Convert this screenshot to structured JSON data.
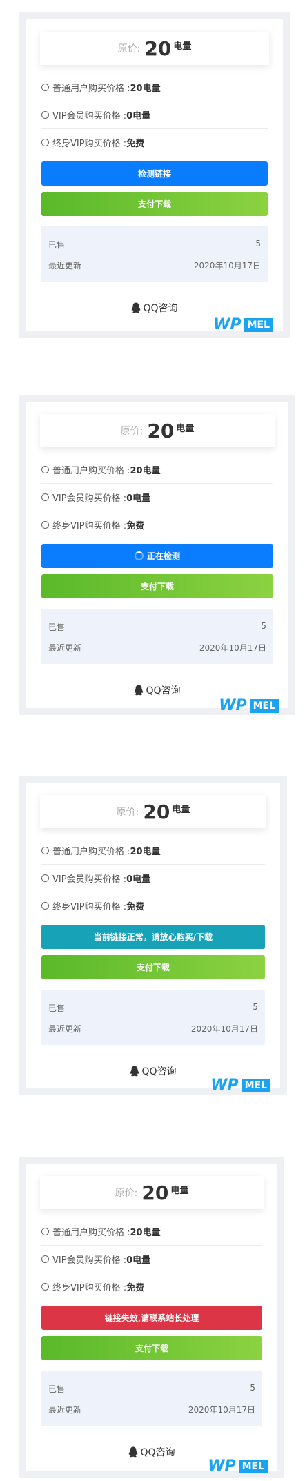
{
  "cards": [
    {
      "price_label": "原价:",
      "price_value": "20",
      "price_unit": "电量",
      "options": [
        {
          "label": "普通用户购买价格 : ",
          "value": "20电量"
        },
        {
          "label": "VIP会员购买价格 : ",
          "value": "0电量"
        },
        {
          "label": "终身VIP购买价格 : ",
          "value": "免费"
        }
      ],
      "check_button": "检测链接",
      "check_state": "default",
      "pay_button": "支付下载",
      "sold_label": "已售",
      "sold_value": "5",
      "updated_label": "最近更新",
      "updated_value": "2020年10月17日",
      "qq_label": "QQ咨询",
      "logo_wp": "WP",
      "logo_mel": "MEL"
    },
    {
      "price_label": "原价:",
      "price_value": "20",
      "price_unit": "电量",
      "options": [
        {
          "label": "普通用户购买价格 : ",
          "value": "20电量"
        },
        {
          "label": "VIP会员购买价格 : ",
          "value": "0电量"
        },
        {
          "label": "终身VIP购买价格 : ",
          "value": "免费"
        }
      ],
      "check_button": "正在检测",
      "check_state": "loading",
      "pay_button": "支付下载",
      "sold_label": "已售",
      "sold_value": "5",
      "updated_label": "最近更新",
      "updated_value": "2020年10月17日",
      "qq_label": "QQ咨询",
      "logo_wp": "WP",
      "logo_mel": "MEL"
    },
    {
      "price_label": "原价:",
      "price_value": "20",
      "price_unit": "电量",
      "options": [
        {
          "label": "普通用户购买价格 : ",
          "value": "20电量"
        },
        {
          "label": "VIP会员购买价格 : ",
          "value": "0电量"
        },
        {
          "label": "终身VIP购买价格 : ",
          "value": "免费"
        }
      ],
      "check_button": "当前链接正常，请放心购买/下载",
      "check_state": "success",
      "pay_button": "支付下载",
      "sold_label": "已售",
      "sold_value": "5",
      "updated_label": "最近更新",
      "updated_value": "2020年10月17日",
      "qq_label": "QQ咨询",
      "logo_wp": "WP",
      "logo_mel": "MEL"
    },
    {
      "price_label": "原价:",
      "price_value": "20",
      "price_unit": "电量",
      "options": [
        {
          "label": "普通用户购买价格 : ",
          "value": "20电量"
        },
        {
          "label": "VIP会员购买价格 : ",
          "value": "0电量"
        },
        {
          "label": "终身VIP购买价格 : ",
          "value": "免费"
        }
      ],
      "check_button": "链接失效,请联系站长处理",
      "check_state": "error",
      "pay_button": "支付下载",
      "sold_label": "已售",
      "sold_value": "5",
      "updated_label": "最近更新",
      "updated_value": "2020年10月17日",
      "qq_label": "QQ咨询",
      "logo_wp": "WP",
      "logo_mel": "MEL"
    }
  ],
  "colors": {
    "default": "#0a7cfe",
    "loading": "#0a7cfe",
    "success": "#17a2b8",
    "error": "#dc3545",
    "pay": "#6cc42f",
    "logo": "#1aa3f0"
  }
}
